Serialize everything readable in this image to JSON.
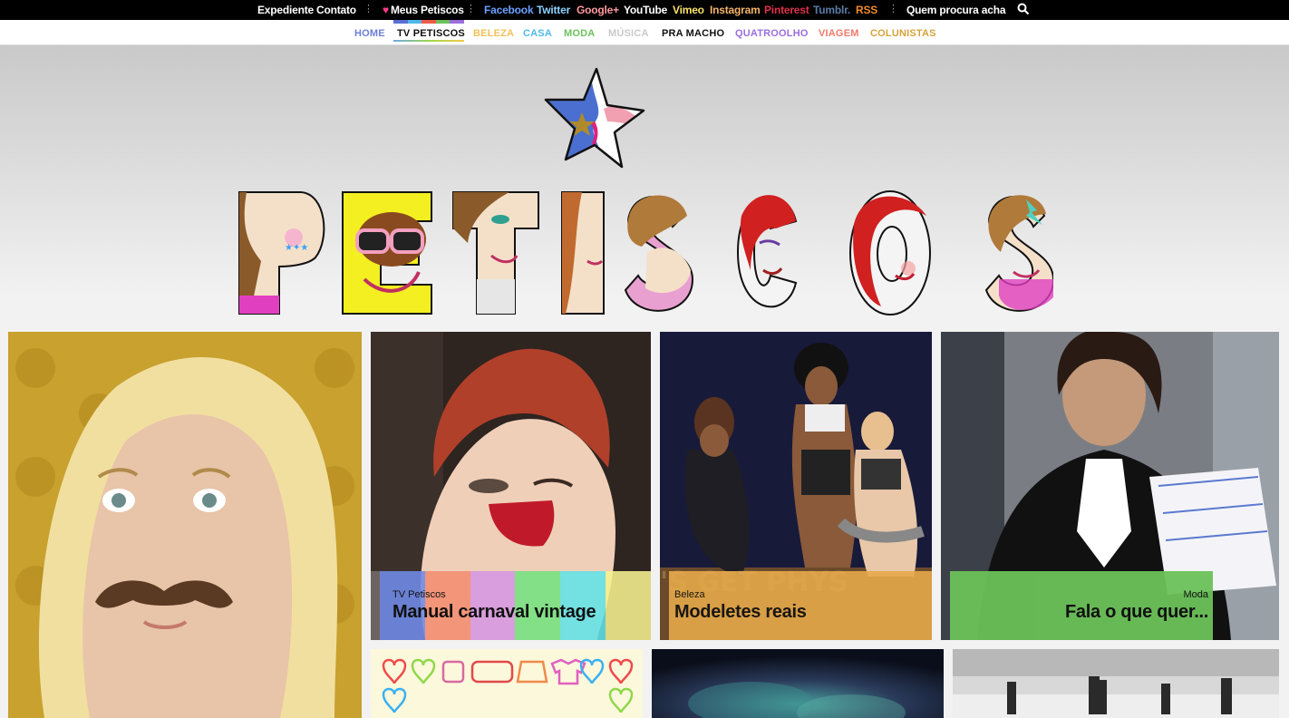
{
  "topbar": {
    "items": [
      {
        "label": "Expediente",
        "color": "#ffffff"
      },
      {
        "label": "Contato",
        "color": "#ffffff"
      },
      {
        "label": "Meus Petiscos",
        "color": "#ffffff"
      },
      {
        "label": "Facebook",
        "color": "#6aa0ff"
      },
      {
        "label": "Twitter",
        "color": "#8ed3ff"
      },
      {
        "label": "Google+",
        "color": "#ff9aa0"
      },
      {
        "label": "YouTube",
        "color": "#ffffff"
      },
      {
        "label": "Vimeo",
        "color": "#f7e26b"
      },
      {
        "label": "Instagram",
        "color": "#f4b56a"
      },
      {
        "label": "Pinterest",
        "color": "#e0304a"
      },
      {
        "label": "Tumblr.",
        "color": "#5b7ca8"
      },
      {
        "label": "RSS",
        "color": "#f08a2a"
      },
      {
        "label": "Quem procura acha",
        "color": "#ffffff"
      }
    ],
    "heart": "♥"
  },
  "catnav": {
    "items": [
      {
        "label": "HOME",
        "color": "#6b7fd6"
      },
      {
        "label": "TV PETISCOS",
        "color": "#111111"
      },
      {
        "label": "BELEZA",
        "color": "#f4c15b"
      },
      {
        "label": "CASA",
        "color": "#4fb9e6"
      },
      {
        "label": "MODA",
        "color": "#6cc25a"
      },
      {
        "label": "MÚSICA",
        "color": "#c9c9c9"
      },
      {
        "label": "PRA MACHO",
        "color": "#111111"
      },
      {
        "label": "QUATROOLHO",
        "color": "#9a6ee0"
      },
      {
        "label": "VIAGEM",
        "color": "#f07a6a"
      },
      {
        "label": "COLUNISTAS",
        "color": "#d6a33a"
      }
    ],
    "stripe_colors": [
      "#5b6fd6",
      "#4fb9e6",
      "#ef5a4a",
      "#6cc25a",
      "#9a6ee0"
    ]
  },
  "logo": {
    "text": "PETISCOS"
  },
  "cards": [
    {
      "category": "TV Petiscos",
      "title": "Manual carnaval vintage"
    },
    {
      "category": "Beleza",
      "title": "Modeletes reais"
    },
    {
      "category": "Moda",
      "title": "Fala o que quer..."
    }
  ]
}
